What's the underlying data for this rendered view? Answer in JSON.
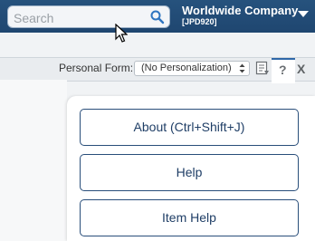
{
  "header": {
    "search": {
      "placeholder": "Search",
      "value": ""
    },
    "company_name": "Worldwide Company",
    "company_code": "[JPD920]"
  },
  "formbar": {
    "label": "Personal Form:",
    "selected": "(No Personalization)"
  },
  "help_menu": {
    "items": [
      {
        "label": "About (Ctrl+Shift+J)"
      },
      {
        "label": "Help"
      },
      {
        "label": "Item Help"
      }
    ]
  },
  "icons": {
    "search": "search-icon",
    "company_dropdown": "caret-down-icon",
    "document": "document-icon",
    "help": "help-icon",
    "close": "close-icon"
  },
  "colors": {
    "header_bg": "#1f4670",
    "button_border": "#294e7a",
    "button_text": "#1f3e66",
    "help_active": "#2f67a8"
  }
}
